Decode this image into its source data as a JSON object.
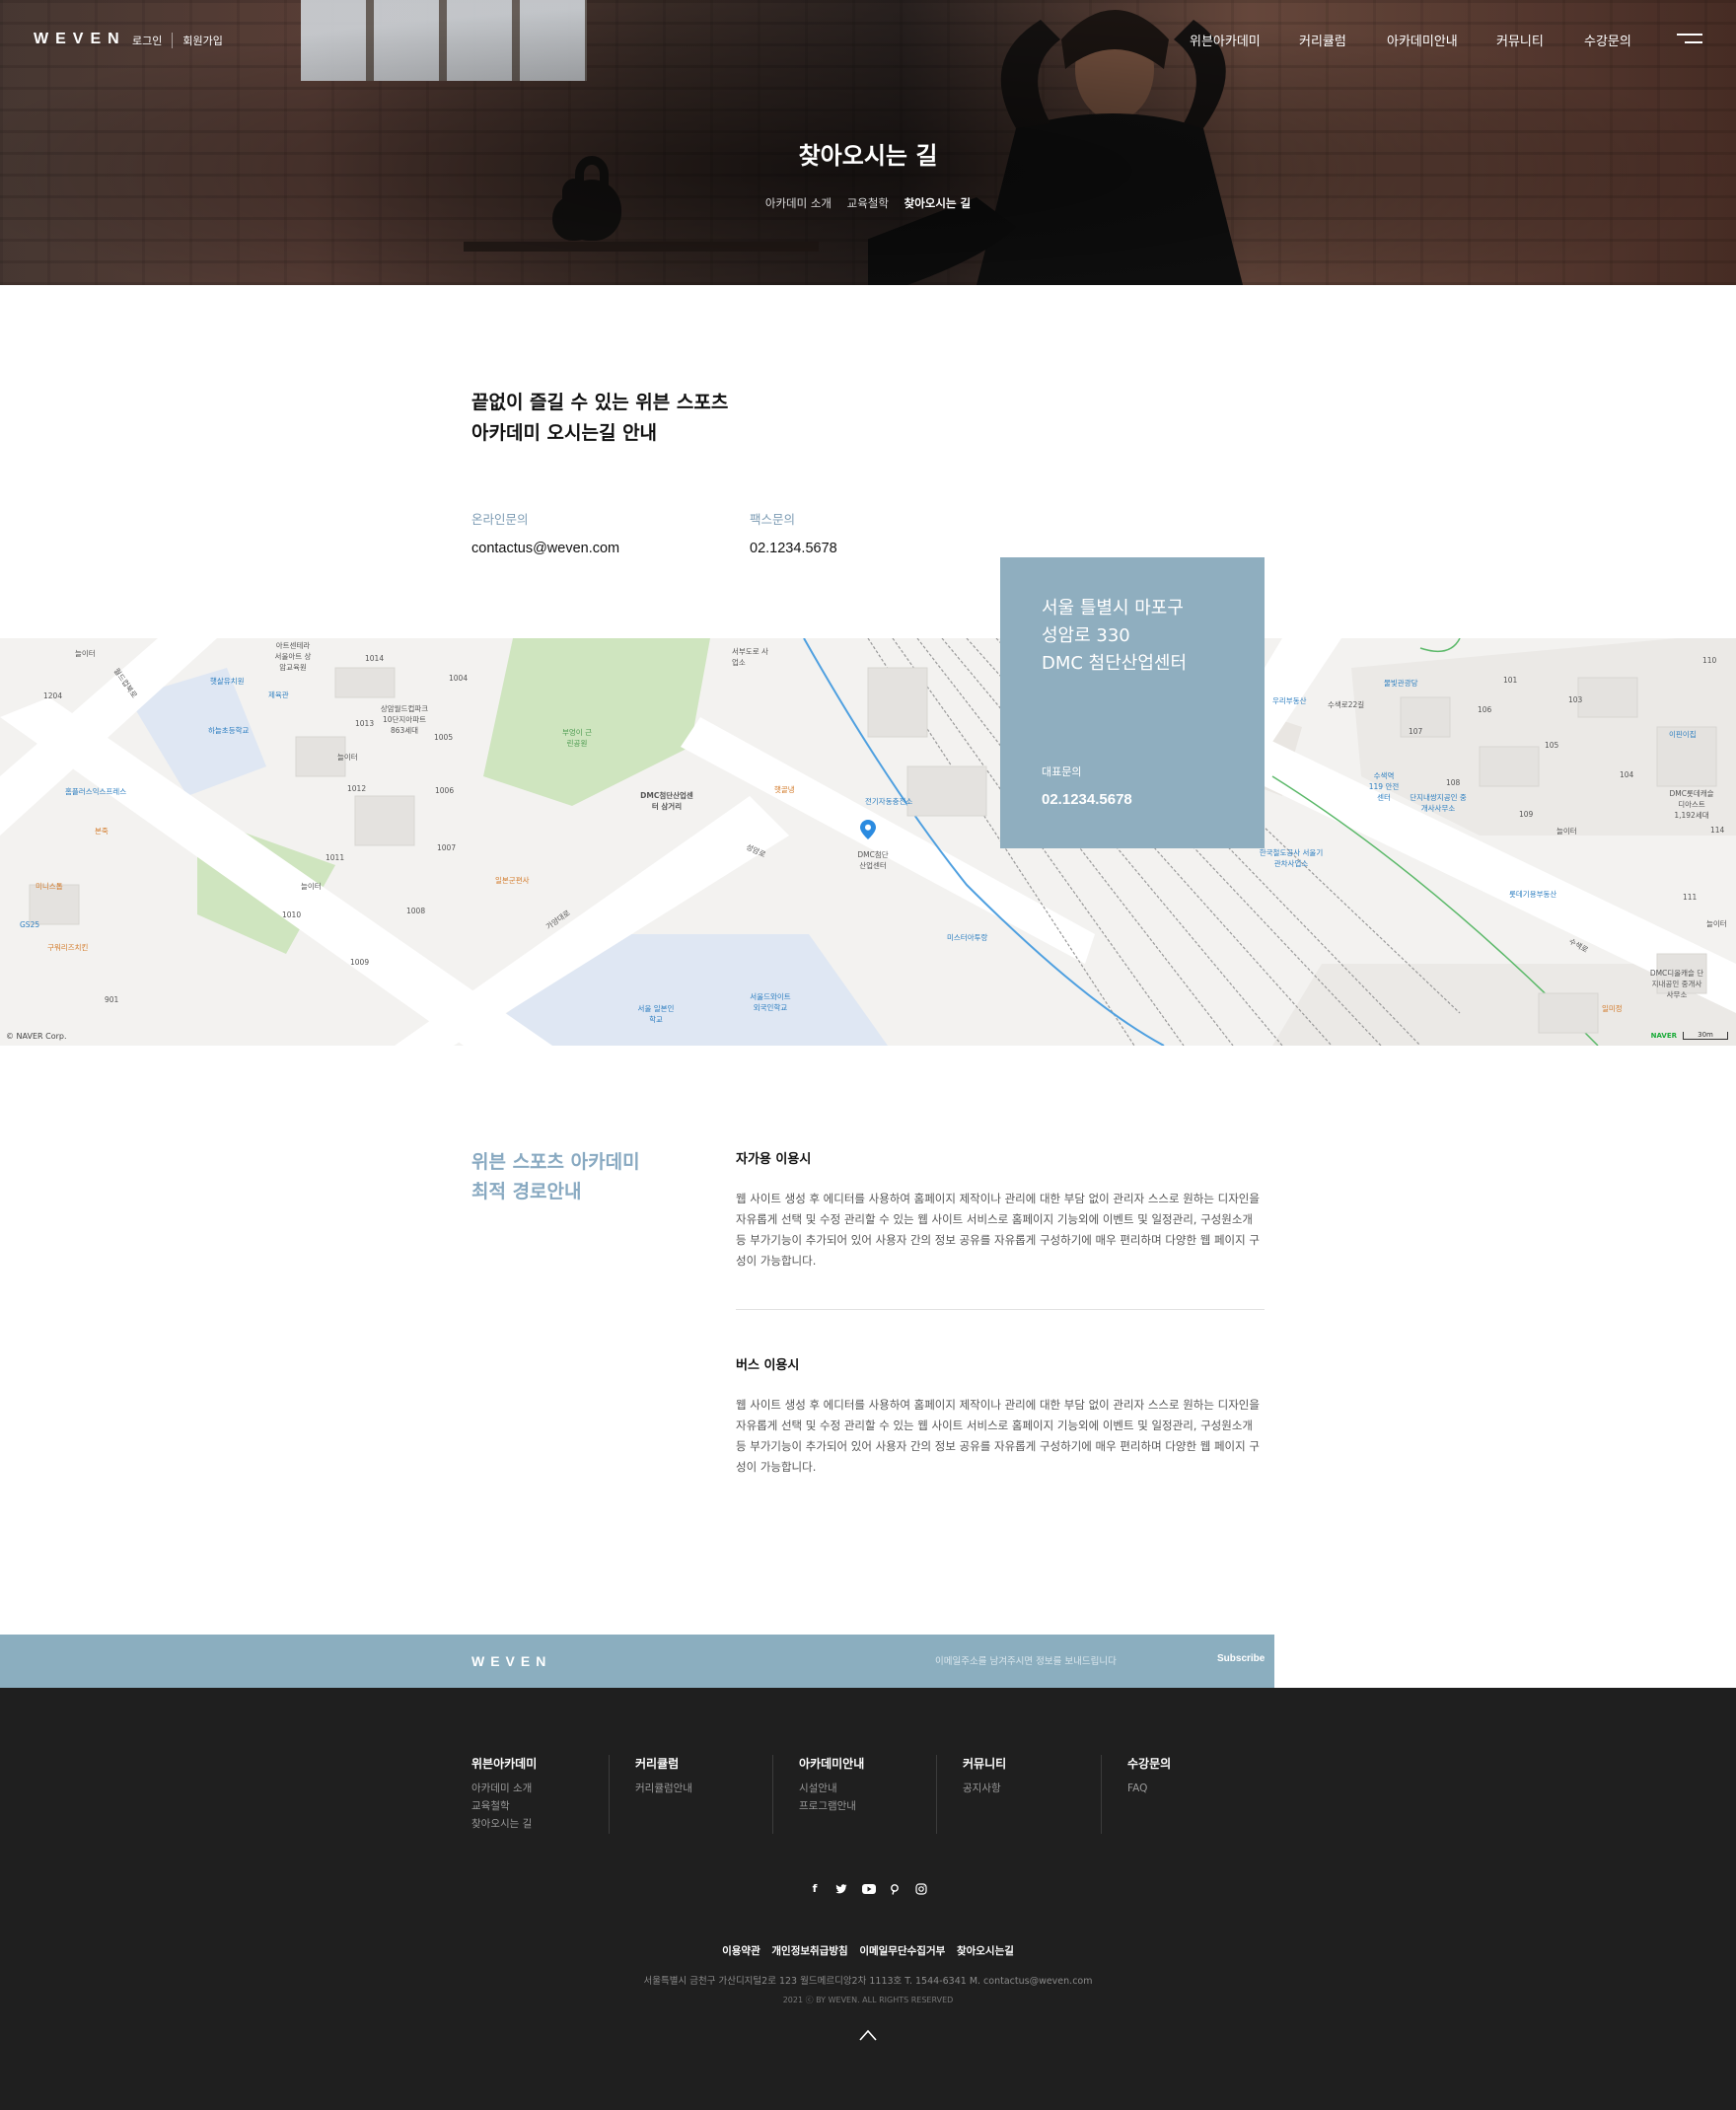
{
  "header": {
    "logo": "WEVEN",
    "login": "로그인",
    "signup": "회원가입",
    "nav": [
      "위븐아카데미",
      "커리큘럼",
      "아카데미안내",
      "커뮤니티",
      "수강문의"
    ]
  },
  "hero": {
    "title": "찾아오시는 길",
    "breadcrumb": [
      "아카데미 소개",
      "교육철학",
      "찾아오시는 길"
    ]
  },
  "intro": {
    "heading_line1": "끝없이 즐길 수 있는 위븐 스포츠",
    "heading_line2": "아카데미 오시는길 안내",
    "online_label": "온라인문의",
    "online_value": "contactus@weven.com",
    "fax_label": "팩스문의",
    "fax_value": "02.1234.5678"
  },
  "address_box": {
    "line1": "서울 틀별시 마포구",
    "line2": "성암로 330",
    "line3": "DMC 첨단산업센터",
    "tel_label": "대표문의",
    "tel_value": "02.1234.5678"
  },
  "map": {
    "copyright": "© NAVER Corp.",
    "naver": "NAVER",
    "scale": "30m",
    "labels": {
      "l01": "아트센테라 서울아트 상암교육원",
      "l02": "1014",
      "l03": "1004",
      "l04": "서부도로 사업소",
      "l05": "햇살유치원",
      "l06": "제육관",
      "l07": "상암월드컵파크 10단지아파트 863세대",
      "l08": "하늘초등학교",
      "l09": "1013",
      "l10": "1005",
      "l11": "늘이터",
      "l12": "부엉이 근린공원",
      "l13": "DMC첨단산업센터 삼거리",
      "l14": "햇골냉",
      "l15": "전기자동충전소",
      "l16": "DMC첨단 산업센터",
      "l17": "홈플러스익스프레스",
      "l18": "1012",
      "l19": "1006",
      "l20": "본죽",
      "l21": "1011",
      "l22": "1007",
      "l23": "일본군편사",
      "l24": "미니스톱",
      "l25": "GS25",
      "l26": "구워리즈치킨",
      "l27": "1010",
      "l28": "1008",
      "l29": "1009",
      "l30": "늘이터",
      "l31": "미스터아투랑",
      "l32": "서울 일본인학교",
      "l33": "서울드와이트 외국인학교",
      "l34": "위례부동산",
      "l35": "물빛관광당",
      "l36": "우리부동산",
      "l37": "수색역 119 안전센터",
      "l38": "단지내쌍지공인 중개사사무소",
      "l39": "한국철도공사 서울기관차사업소",
      "l40": "롯데기용부동산",
      "l41": "DMC롯데캐슬 디아스트 1,192세대",
      "l42": "DMC디올캐슬 단지내공인 중개사사무소",
      "l43": "이핀이집",
      "l44": "일미정",
      "l45": "101",
      "l46": "103",
      "l47": "106",
      "l48": "107",
      "l49": "108",
      "l50": "105",
      "l51": "109",
      "l52": "110",
      "l53": "104",
      "l54": "114",
      "l55": "111",
      "l56": "늘이터",
      "l57": "늘이터",
      "l58": "1204",
      "l59": "901",
      "l60": "수색로22길",
      "l61": "월드컵북로",
      "l62": "성암로",
      "l63": "가양대로",
      "l64": "수색로",
      "l65": "늘이터"
    }
  },
  "route": {
    "heading_line1": "위븐 스포츠 아카데미",
    "heading_line2": "최적 경로안내",
    "car_title": "자가용 이용시",
    "car_text": "웹 사이트 생성 후 에디터를 사용하여 홈페이지 제작이나 관리에 대한 부담 없이 관리자 스스로 원하는 디자인을 자유롭게 선택 및 수정 관리할 수 있는 웹 사이트 서비스로 홈페이지 기능외에 이벤트 및 일정관리, 구성원소개 등 부가기능이 추가되어 있어 사용자 간의 정보 공유를 자유롭게 구성하기에 매우 편리하며 다양한 웹 페이지 구성이 가능합니다.",
    "bus_title": "버스 이용시",
    "bus_text": "웹 사이트 생성 후 에디터를 사용하여 홈페이지 제작이나 관리에 대한 부담 없이 관리자 스스로 원하는 디자인을 자유롭게 선택 및 수정 관리할 수 있는 웹 사이트 서비스로 홈페이지 기능외에 이벤트 및 일정관리, 구성원소개 등 부가기능이 추가되어 있어 사용자 간의 정보 공유를 자유롭게 구성하기에 매우 편리하며 다양한 웹 페이지 구성이 가능합니다."
  },
  "newsletter": {
    "logo": "WEVEN",
    "placeholder": "이메일주소를 남겨주시면 정보를 보내드립니다",
    "button": "Subscribe"
  },
  "footer": {
    "columns": [
      {
        "title": "위븐아카데미",
        "links": [
          "아카데미 소개",
          "교육철학",
          "찾아오시는 길"
        ]
      },
      {
        "title": "커리큘럼",
        "links": [
          "커리큘럼안내"
        ]
      },
      {
        "title": "아카데미안내",
        "links": [
          "시설안내",
          "프로그램안내"
        ]
      },
      {
        "title": "커뮤니티",
        "links": [
          "공지사항"
        ]
      },
      {
        "title": "수강문의",
        "links": [
          "FAQ"
        ]
      }
    ],
    "social": [
      "facebook-icon",
      "twitter-icon",
      "youtube-icon",
      "pinterest-icon",
      "instagram-icon"
    ],
    "links": [
      "이용약관",
      "개인정보취급방침",
      "이메일무단수집거부",
      "찾아오시는길"
    ],
    "info": "서울특별시 금천구 가산디지털2로 123 월드메르디앙2차 1113호   T. 1544-6341   M. contactus@weven.com",
    "copyright": "2021 ⓒ BY WEVEN. ALL RIGHTS RESERVED"
  },
  "colors": {
    "accent": "#8faebf",
    "accent_text": "#88a9c1",
    "footer_bg": "#1f1f1f",
    "map_bg": "#f4f3f1"
  }
}
